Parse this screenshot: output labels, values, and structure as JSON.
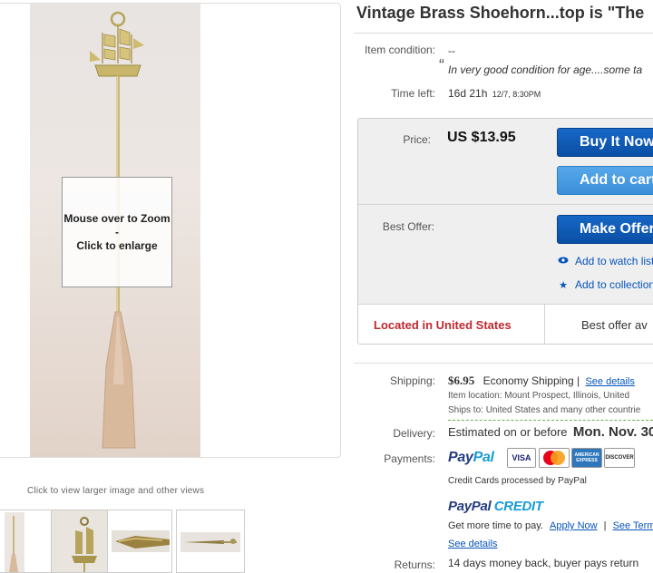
{
  "gallery": {
    "zoom_line1": "Mouse over to Zoom",
    "zoom_line2": "-",
    "zoom_line3": "Click to enlarge",
    "caption": "Click to view larger image and other views"
  },
  "item": {
    "title": "Vintage Brass Shoehorn...top is \"The",
    "condition_label": "Item condition:",
    "condition_value": "--",
    "condition_quote_mark": "“",
    "condition_note": "In very good condition for age....some ta",
    "time_left_label": "Time left:",
    "time_left_value": "16d 21h",
    "time_left_date": "12/7, 8:30PM"
  },
  "offer": {
    "price_label": "Price:",
    "price_value": "US $13.95",
    "buy_now": "Buy It Now",
    "add_to_cart": "Add to cart",
    "best_offer_label": "Best Offer:",
    "make_offer": "Make Offer",
    "watch_list": "Add to watch list",
    "collection": "Add to collection",
    "location": "Located in United States",
    "best_offer_available": "Best offer av",
    "location_color": "#c0282f"
  },
  "shipping": {
    "label": "Shipping:",
    "price": "$6.95",
    "method": "Economy Shipping |",
    "details_link": "See details",
    "location": "Item location:  Mount Prospect, Illinois, United",
    "ships_to": "Ships to:  United States and many other countrie"
  },
  "delivery": {
    "label": "Delivery:",
    "prefix": "Estimated on or before",
    "date": "Mon. Nov. 30"
  },
  "payments": {
    "label": "Payments:",
    "paypal_dark": "Pay",
    "paypal_light": "Pal",
    "cards": [
      "VISA",
      "MasterCard",
      "AMERICAN EXPRESS",
      "DISCOVER"
    ],
    "cards_note": "Credit Cards processed by PayPal",
    "credit_dark": "PayPal",
    "credit_light": "CREDIT",
    "credit_text": "Get more time to pay.",
    "apply_link": "Apply Now",
    "separator": "|",
    "terms_link": "See Terms",
    "see_details": "See details"
  },
  "returns": {
    "label": "Returns:",
    "value": "14 days money back, buyer pays return"
  }
}
